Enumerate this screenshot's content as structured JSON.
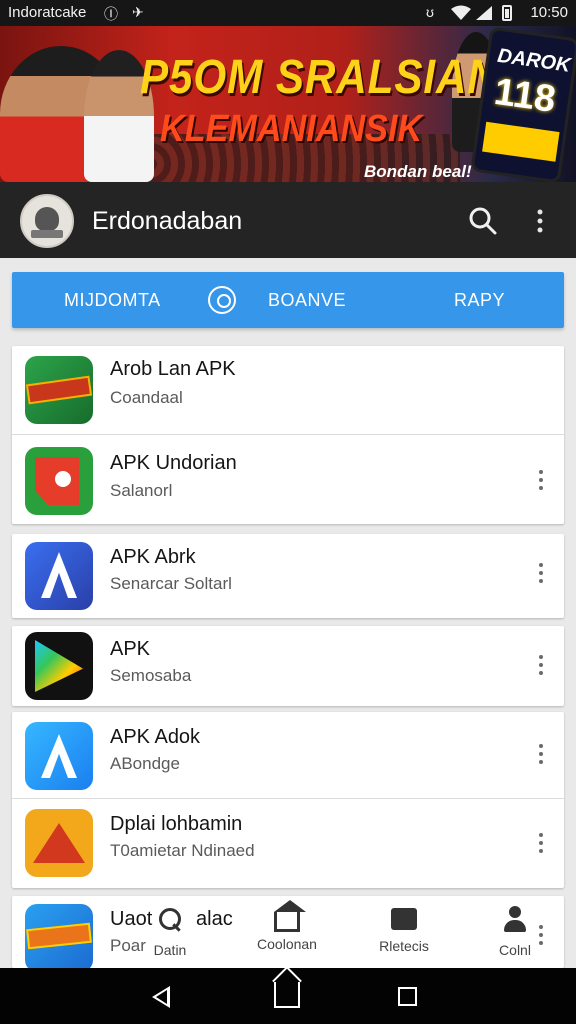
{
  "status_bar": {
    "carrier": "Indoratcake",
    "icon_left_1": "Ⓘ",
    "icon_left_2": "✈",
    "icon_right": "ʊ",
    "time": "10:50"
  },
  "banner": {
    "title": "P5OM SRALSIAN",
    "subtitle": "KLEMANIANSIK",
    "tagline": "Bondan beal!",
    "phone_text_1": "DAROK",
    "phone_text_2": "118",
    "colors": {
      "title": "#ffd21a",
      "subtitle": "#ff4a1c"
    }
  },
  "app_bar": {
    "title": "Erdonadaban",
    "search_icon": "search-icon",
    "more_icon": "more-vert-icon"
  },
  "tabs": {
    "items": [
      "MIJDOMTA",
      "BOANVE",
      "RAPY"
    ],
    "icon": "tab-center-icon",
    "color": "#3596ea"
  },
  "apps": [
    {
      "name": "Arob Lan APK",
      "subtitle": "Coandaal",
      "icon": "app-icon-green-banner"
    },
    {
      "name": "APK Undorian",
      "subtitle": "Salanorl",
      "icon": "app-icon-red-green"
    },
    {
      "name": "APK Abrk",
      "subtitle": "Senarcar Soltarl",
      "icon": "app-icon-blue-a"
    },
    {
      "name": "APK",
      "subtitle": "Semosaba",
      "icon": "app-icon-play-triangle"
    },
    {
      "name": "APK Adok",
      "subtitle": "ABondge",
      "icon": "app-icon-blue-a-light"
    },
    {
      "name": "Dplai lohbamin",
      "subtitle": "T0amietar Ndinaed",
      "icon": "app-icon-orange-triangle"
    },
    {
      "name": "Uaot",
      "name_suffix": "alac",
      "subtitle": "Poar",
      "icon": "app-icon-blue-banner"
    }
  ],
  "bottom_nav": {
    "items": [
      {
        "label": "Datin",
        "icon": "search-icon"
      },
      {
        "label": "Coolonan",
        "icon": "home-icon"
      },
      {
        "label": "Rletecis",
        "icon": "folder-icon"
      },
      {
        "label": "Colnl",
        "icon": "person-icon"
      }
    ]
  },
  "system_nav": {
    "back_icon": "back-icon",
    "home_icon": "home-icon",
    "recents_icon": "recents-icon"
  }
}
